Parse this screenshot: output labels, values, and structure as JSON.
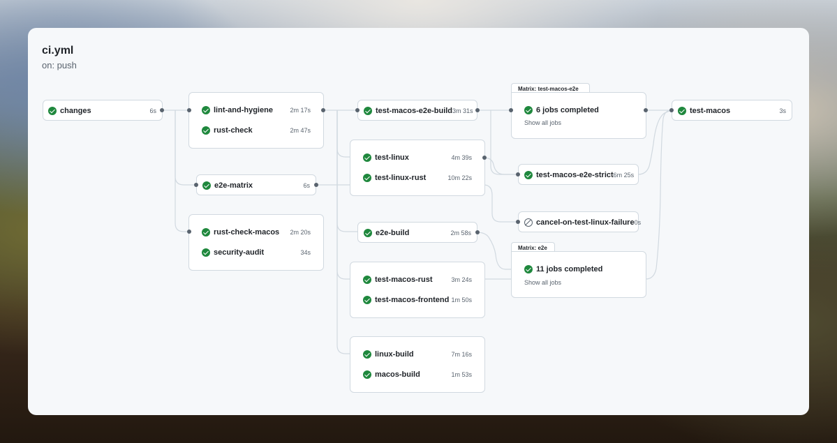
{
  "workflow": {
    "title": "ci.yml",
    "trigger": "on: push"
  },
  "icons": {
    "success": "check-circle-icon",
    "skipped": "skip-circle-icon"
  },
  "colors": {
    "success": "#1f883d",
    "border": "#d1d9e0",
    "text": "#1f2328",
    "muted": "#59636e"
  },
  "jobs": {
    "changes": {
      "name": "changes",
      "duration": "6s"
    },
    "lint_and_hygiene": {
      "name": "lint-and-hygiene",
      "duration": "2m 17s"
    },
    "rust_check": {
      "name": "rust-check",
      "duration": "2m 47s"
    },
    "e2e_matrix": {
      "name": "e2e-matrix",
      "duration": "6s"
    },
    "rust_check_macos": {
      "name": "rust-check-macos",
      "duration": "2m 20s"
    },
    "security_audit": {
      "name": "security-audit",
      "duration": "34s"
    },
    "test_macos_e2e_build": {
      "name": "test-macos-e2e-build",
      "duration": "3m 31s"
    },
    "test_linux": {
      "name": "test-linux",
      "duration": "4m 39s"
    },
    "test_linux_rust": {
      "name": "test-linux-rust",
      "duration": "10m 22s"
    },
    "e2e_build": {
      "name": "e2e-build",
      "duration": "2m 58s"
    },
    "test_macos_rust": {
      "name": "test-macos-rust",
      "duration": "3m 24s"
    },
    "test_macos_frontend": {
      "name": "test-macos-frontend",
      "duration": "1m 50s"
    },
    "linux_build": {
      "name": "linux-build",
      "duration": "7m 16s"
    },
    "macos_build": {
      "name": "macos-build",
      "duration": "1m 53s"
    },
    "test_macos_e2e_strict": {
      "name": "test-macos-e2e-strict",
      "duration": "6m 25s"
    },
    "cancel_on_test_linux_failure": {
      "name": "cancel-on-test-linux-failure",
      "duration": "0s"
    },
    "test_macos": {
      "name": "test-macos",
      "duration": "3s"
    }
  },
  "matrices": {
    "test_macos_e2e": {
      "label": "Matrix: test-macos-e2e",
      "summary": "6 jobs completed",
      "link": "Show all jobs"
    },
    "e2e": {
      "label": "Matrix: e2e",
      "summary": "11 jobs completed",
      "link": "Show all jobs"
    }
  }
}
